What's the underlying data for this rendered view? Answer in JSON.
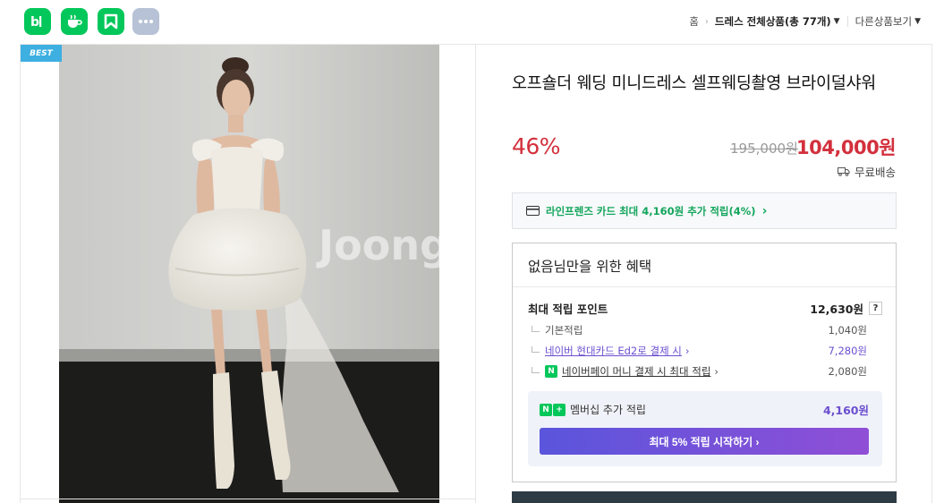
{
  "apps": [
    {
      "name": "blog",
      "icon": "blog-icon",
      "text": "b|"
    },
    {
      "name": "cafe",
      "icon": "cafe-icon"
    },
    {
      "name": "bands",
      "icon": "bookmark-icon"
    },
    {
      "name": "more",
      "icon": "more-icon"
    }
  ],
  "breadcrumb": {
    "home": "홈",
    "category": "드레스 전체상품(총 77개)",
    "other": "다른상품보기"
  },
  "product": {
    "badge": "BEST",
    "title": "오프숄더 웨딩 미니드레스 셀프웨딩촬영 브라이덜샤워",
    "discount_rate": "46%",
    "original_price": "195,000원",
    "sale_price": "104,000원",
    "shipping": "무료배송",
    "watermark": "Joong"
  },
  "card_banner": {
    "text": "라인프렌즈 카드 최대 4,160원 추가 적립(4%)",
    "chevron": "›"
  },
  "benefits": {
    "title": "없음님만을 위한 혜택",
    "max_points_label": "최대 적립 포인트",
    "max_points_value": "12,630원",
    "help": "?",
    "base_label": "기본적립",
    "base_value": "1,040원",
    "hyundai_label": "네이버 현대카드 Ed2로 결제 시",
    "hyundai_value": "7,280원",
    "npay_label": "네이버페이 머니 결제 시 최대 적립",
    "npay_value": "2,080원",
    "npay_badge": "N",
    "membership_label": "멤버십 추가 적립",
    "membership_value": "4,160원",
    "membership_button": "최대 5% 적립 시작하기 ›"
  },
  "colors": {
    "brand_green": "#03c75a",
    "sale_red": "#d3303d",
    "points_purple": "#6b4fd1",
    "best_badge": "#3dafe0"
  }
}
